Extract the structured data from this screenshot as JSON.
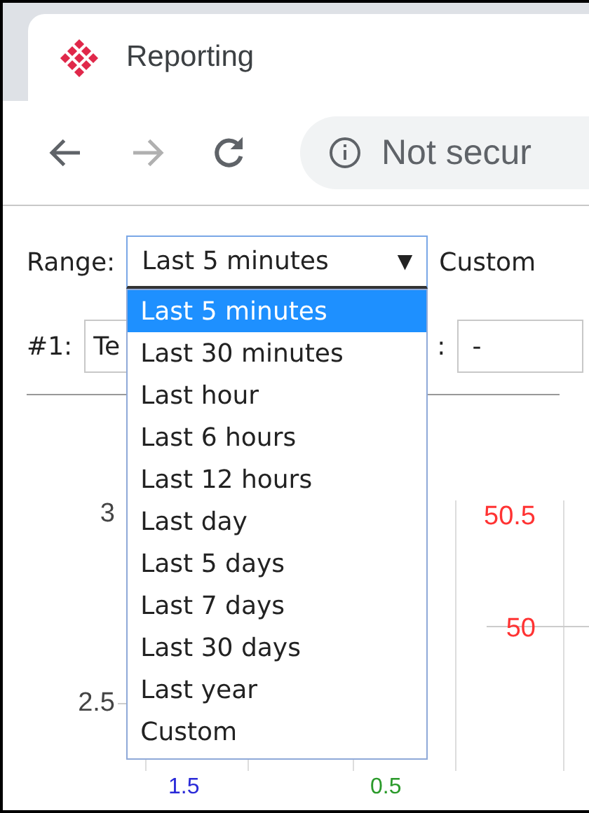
{
  "tab": {
    "title": "Reporting"
  },
  "toolbar": {
    "back_disabled": false,
    "forward_disabled": true,
    "address": "Not secur"
  },
  "range": {
    "label": "Range:",
    "value": "Last 5 minutes",
    "caret": "▼",
    "custom_label": "Custom",
    "expanded": true,
    "options": [
      {
        "label": "Last 5 minutes",
        "selected": true
      },
      {
        "label": "Last 30 minutes",
        "selected": false
      },
      {
        "label": "Last hour",
        "selected": false
      },
      {
        "label": "Last 6 hours",
        "selected": false
      },
      {
        "label": "Last 12 hours",
        "selected": false
      },
      {
        "label": "Last day",
        "selected": false
      },
      {
        "label": "Last 5 days",
        "selected": false
      },
      {
        "label": "Last 7 days",
        "selected": false
      },
      {
        "label": "Last 30 days",
        "selected": false
      },
      {
        "label": "Last year",
        "selected": false
      },
      {
        "label": "Custom",
        "selected": false
      }
    ]
  },
  "series_row": {
    "label": "#1:",
    "value": "Te",
    "second_label": ":",
    "second_value": "-"
  },
  "chart": {
    "left_ticks": [
      "3",
      "2.5"
    ],
    "right_ticks": [
      "50.5",
      "50"
    ],
    "bottom_labels": [
      {
        "text": "1.5",
        "color": "#2a2ad8"
      },
      {
        "text": "0.5",
        "color": "#2a9a2a"
      }
    ]
  }
}
